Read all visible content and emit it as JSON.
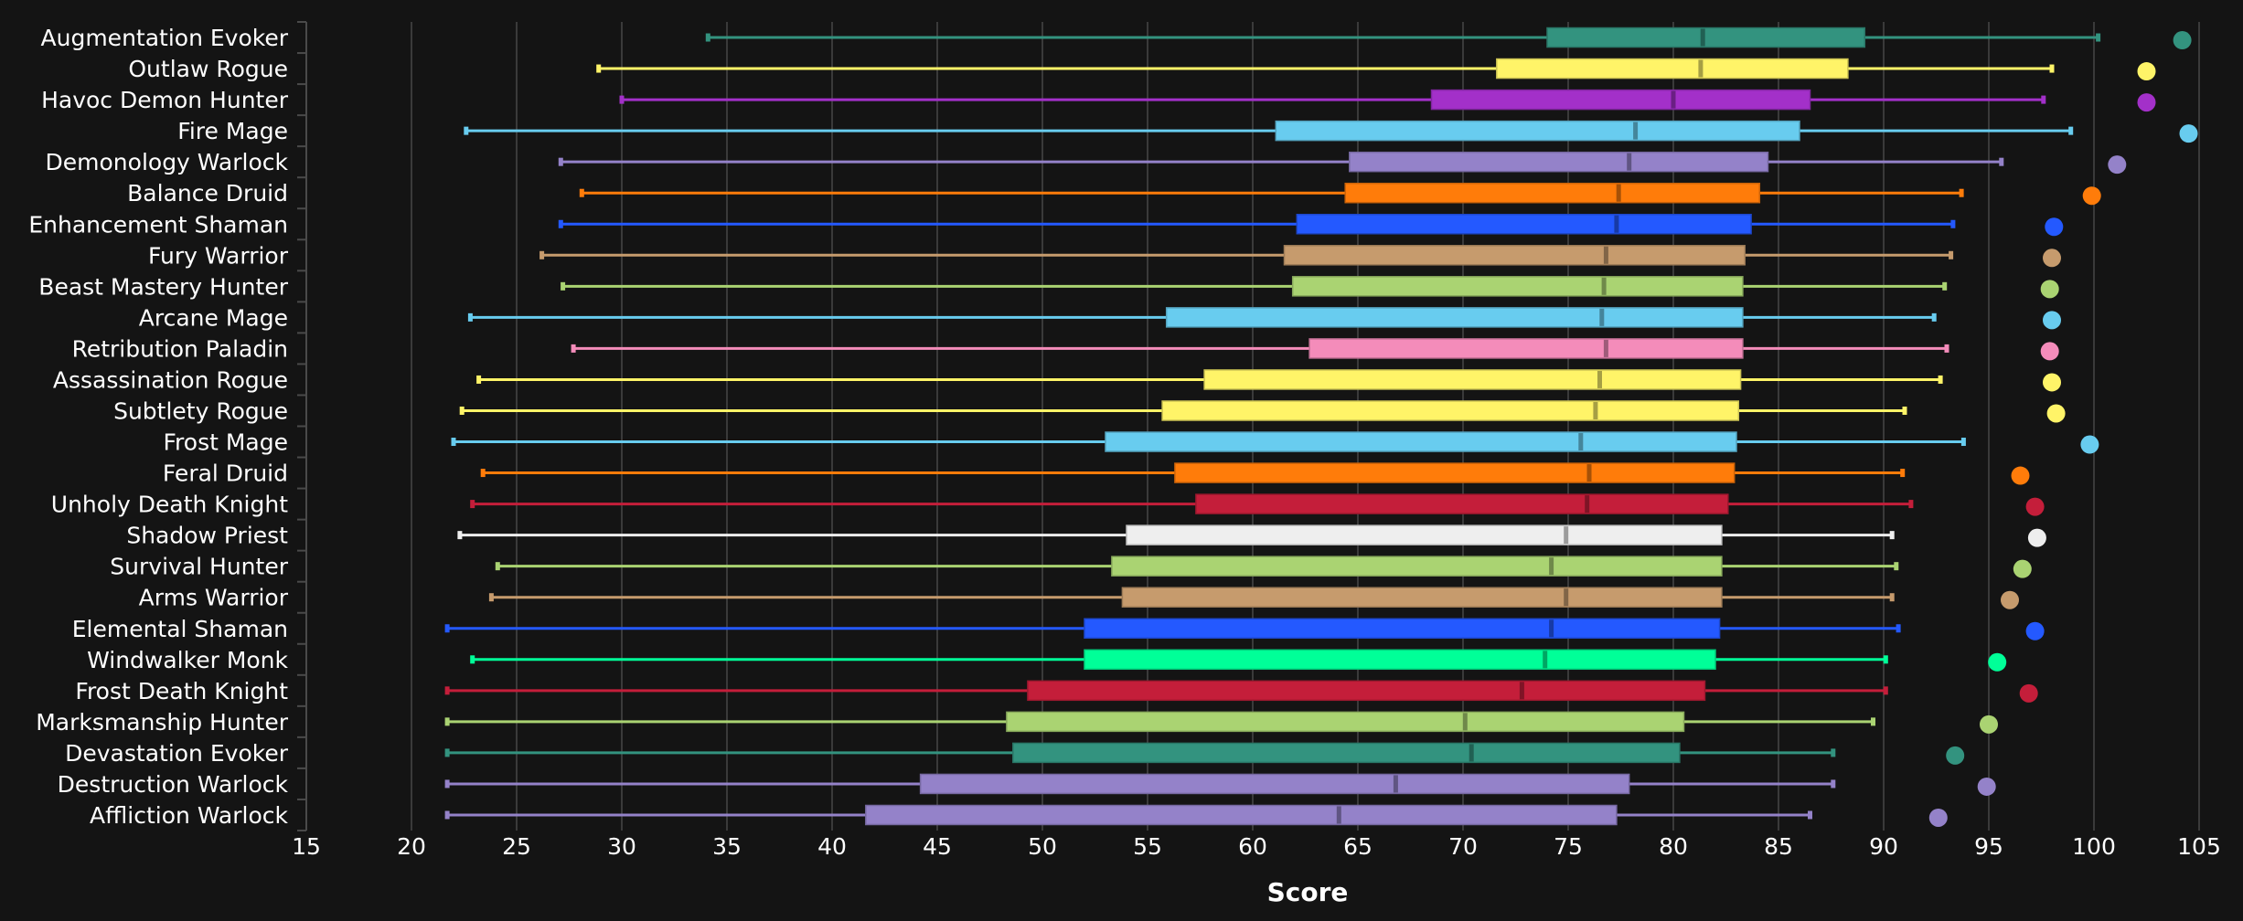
{
  "chart_data": {
    "type": "boxplot",
    "title": "",
    "xlabel": "Score",
    "ylabel": "",
    "xlim": [
      15,
      105
    ],
    "x_ticks": [
      15,
      20,
      25,
      30,
      35,
      40,
      45,
      50,
      55,
      60,
      65,
      70,
      75,
      80,
      85,
      90,
      95,
      100,
      105
    ],
    "x_tick_labels": [
      "15",
      "20",
      "25",
      "30",
      "35",
      "40",
      "45",
      "50",
      "55",
      "60",
      "65",
      "70",
      "75",
      "80",
      "85",
      "90",
      "95",
      "100",
      "105"
    ],
    "grid": "vertical",
    "legend": "none",
    "background": "#141414",
    "categories": [
      "Augmentation Evoker",
      "Outlaw Rogue",
      "Havoc Demon Hunter",
      "Fire Mage",
      "Demonology Warlock",
      "Balance Druid",
      "Enhancement Shaman",
      "Fury Warrior",
      "Beast Mastery Hunter",
      "Arcane Mage",
      "Retribution Paladin",
      "Assassination Rogue",
      "Subtlety Rogue",
      "Frost Mage",
      "Feral Druid",
      "Unholy Death Knight",
      "Shadow Priest",
      "Survival Hunter",
      "Arms Warrior",
      "Elemental Shaman",
      "Windwalker Monk",
      "Frost Death Knight",
      "Marksmanship Hunter",
      "Devastation Evoker",
      "Destruction Warlock",
      "Affliction Warlock"
    ],
    "series": [
      {
        "name": "Augmentation Evoker",
        "color": "#33937F",
        "min": 34.1,
        "q1": 74.0,
        "median": 81.4,
        "q3": 89.1,
        "max": 100.2,
        "outlier": 104.2
      },
      {
        "name": "Outlaw Rogue",
        "color": "#FFF468",
        "min": 28.9,
        "q1": 71.6,
        "median": 81.3,
        "q3": 88.3,
        "max": 98.0,
        "outlier": 102.5
      },
      {
        "name": "Havoc Demon Hunter",
        "color": "#A330C9",
        "min": 30.0,
        "q1": 68.5,
        "median": 80.0,
        "q3": 86.5,
        "max": 97.6,
        "outlier": 102.5
      },
      {
        "name": "Fire Mage",
        "color": "#68CCEF",
        "min": 22.6,
        "q1": 61.1,
        "median": 78.2,
        "q3": 86.0,
        "max": 98.9,
        "outlier": 104.5
      },
      {
        "name": "Demonology Warlock",
        "color": "#9482C9",
        "min": 27.1,
        "q1": 64.6,
        "median": 77.9,
        "q3": 84.5,
        "max": 95.6,
        "outlier": 101.1
      },
      {
        "name": "Balance Druid",
        "color": "#FF7C0A",
        "min": 28.1,
        "q1": 64.4,
        "median": 77.4,
        "q3": 84.1,
        "max": 93.7,
        "outlier": 99.9
      },
      {
        "name": "Enhancement Shaman",
        "color": "#2459FF",
        "min": 27.1,
        "q1": 62.1,
        "median": 77.3,
        "q3": 83.7,
        "max": 93.3,
        "outlier": 98.1
      },
      {
        "name": "Fury Warrior",
        "color": "#C69B6D",
        "min": 26.2,
        "q1": 61.5,
        "median": 76.8,
        "q3": 83.4,
        "max": 93.2,
        "outlier": 98.0
      },
      {
        "name": "Beast Mastery Hunter",
        "color": "#AAD372",
        "min": 27.2,
        "q1": 61.9,
        "median": 76.7,
        "q3": 83.3,
        "max": 92.9,
        "outlier": 97.9
      },
      {
        "name": "Arcane Mage",
        "color": "#68CCEF",
        "min": 22.8,
        "q1": 55.9,
        "median": 76.6,
        "q3": 83.3,
        "max": 92.4,
        "outlier": 98.0
      },
      {
        "name": "Retribution Paladin",
        "color": "#F48CBA",
        "min": 27.7,
        "q1": 62.7,
        "median": 76.8,
        "q3": 83.3,
        "max": 93.0,
        "outlier": 97.9
      },
      {
        "name": "Assassination Rogue",
        "color": "#FFF468",
        "min": 23.2,
        "q1": 57.7,
        "median": 76.5,
        "q3": 83.2,
        "max": 92.7,
        "outlier": 98.0
      },
      {
        "name": "Subtlety Rogue",
        "color": "#FFF468",
        "min": 22.4,
        "q1": 55.7,
        "median": 76.3,
        "q3": 83.1,
        "max": 91.0,
        "outlier": 98.2
      },
      {
        "name": "Frost Mage",
        "color": "#68CCEF",
        "min": 22.0,
        "q1": 53.0,
        "median": 75.6,
        "q3": 83.0,
        "max": 93.8,
        "outlier": 99.8
      },
      {
        "name": "Feral Druid",
        "color": "#FF7C0A",
        "min": 23.4,
        "q1": 56.3,
        "median": 76.0,
        "q3": 82.9,
        "max": 90.9,
        "outlier": 96.5
      },
      {
        "name": "Unholy Death Knight",
        "color": "#C41E3A",
        "min": 22.9,
        "q1": 57.3,
        "median": 75.9,
        "q3": 82.6,
        "max": 91.3,
        "outlier": 97.2
      },
      {
        "name": "Shadow Priest",
        "color": "#EEEEEE",
        "min": 22.3,
        "q1": 54.0,
        "median": 74.9,
        "q3": 82.3,
        "max": 90.4,
        "outlier": 97.3
      },
      {
        "name": "Survival Hunter",
        "color": "#AAD372",
        "min": 24.1,
        "q1": 53.3,
        "median": 74.2,
        "q3": 82.3,
        "max": 90.6,
        "outlier": 96.6
      },
      {
        "name": "Arms Warrior",
        "color": "#C69B6D",
        "min": 23.8,
        "q1": 53.8,
        "median": 74.9,
        "q3": 82.3,
        "max": 90.4,
        "outlier": 96.0
      },
      {
        "name": "Elemental Shaman",
        "color": "#2459FF",
        "min": 21.7,
        "q1": 52.0,
        "median": 74.2,
        "q3": 82.2,
        "max": 90.7,
        "outlier": 97.2
      },
      {
        "name": "Windwalker Monk",
        "color": "#00FF98",
        "min": 22.9,
        "q1": 52.0,
        "median": 73.9,
        "q3": 82.0,
        "max": 90.1,
        "outlier": 95.4
      },
      {
        "name": "Frost Death Knight",
        "color": "#C41E3A",
        "min": 21.7,
        "q1": 49.3,
        "median": 72.8,
        "q3": 81.5,
        "max": 90.1,
        "outlier": 96.9
      },
      {
        "name": "Marksmanship Hunter",
        "color": "#AAD372",
        "min": 21.7,
        "q1": 48.3,
        "median": 70.1,
        "q3": 80.5,
        "max": 89.5,
        "outlier": 95.0
      },
      {
        "name": "Devastation Evoker",
        "color": "#33937F",
        "min": 21.7,
        "q1": 48.6,
        "median": 70.4,
        "q3": 80.3,
        "max": 87.6,
        "outlier": 93.4
      },
      {
        "name": "Destruction Warlock",
        "color": "#9482C9",
        "min": 21.7,
        "q1": 44.2,
        "median": 66.8,
        "q3": 77.9,
        "max": 87.6,
        "outlier": 94.9
      },
      {
        "name": "Affliction Warlock",
        "color": "#9482C9",
        "min": 21.7,
        "q1": 41.6,
        "median": 64.1,
        "q3": 77.3,
        "max": 86.5,
        "outlier": 92.6
      }
    ]
  }
}
